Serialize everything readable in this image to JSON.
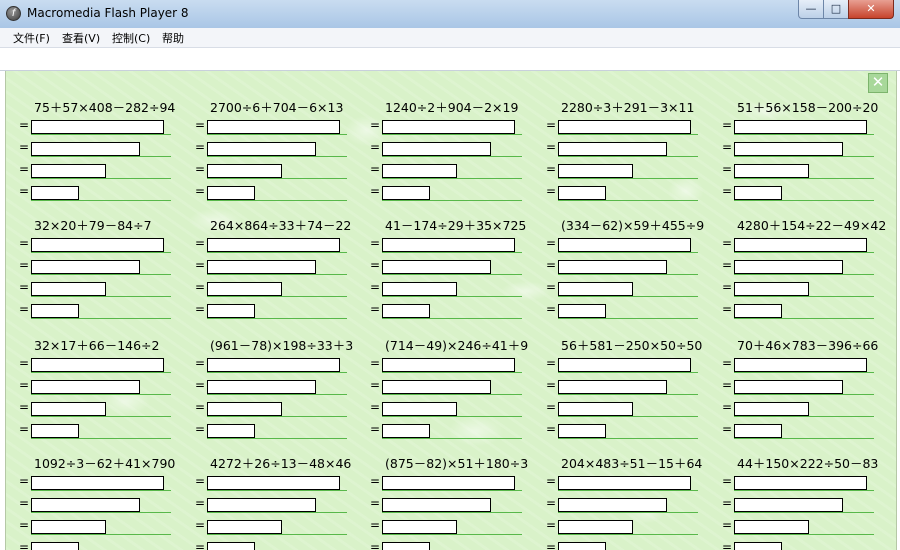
{
  "window": {
    "title": "Macromedia Flash Player 8",
    "icon": "flash-player-icon",
    "app_icon_glyph": "f",
    "minimize_glyph": "—",
    "maximize_glyph": "□",
    "close_glyph": "✕"
  },
  "menu": {
    "items": [
      {
        "label": "文件(F)"
      },
      {
        "label": "查看(V)"
      },
      {
        "label": "控制(C)"
      },
      {
        "label": "帮助"
      }
    ]
  },
  "stage": {
    "background_color": "#d9f2c9",
    "close_glyph": "✕",
    "equals_sign": "="
  },
  "problems": [
    "75＋57×408－282÷94",
    "2700÷6＋704－6×13",
    "1240÷2＋904－2×19",
    "2280÷3＋291－3×11",
    "51＋56×158－200÷20",
    "32×20＋79－84÷7",
    "264×864÷33＋74－22",
    "41－174÷29＋35×725",
    "(334－62)×59＋455÷9",
    "4280＋154÷22－49×42",
    "32×17＋66－146÷2",
    "(961－78)×198÷33＋3",
    "(714－49)×246÷41＋9",
    "56＋581－250×50÷50",
    "70＋46×783－396÷66",
    "1092÷3－62＋41×790",
    "4272＋26÷13－48×46",
    "(875－82)×51＋180÷3",
    "204×483÷51－15＋64",
    "44＋150×222÷50－83"
  ]
}
